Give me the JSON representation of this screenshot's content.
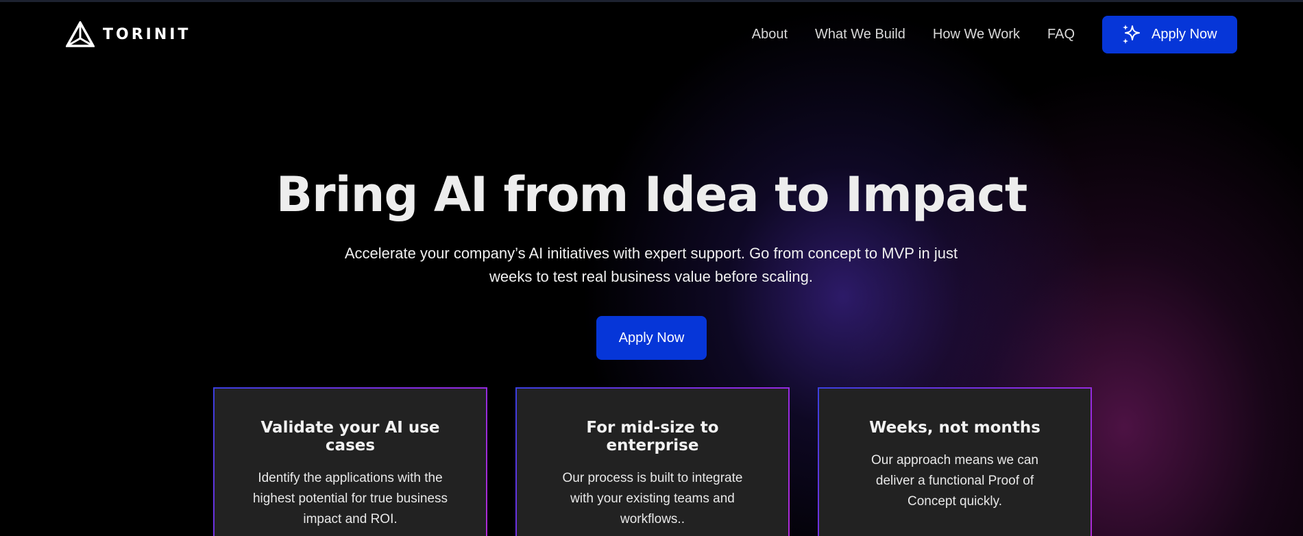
{
  "nav": {
    "brand": "TORINIT",
    "links": [
      "About",
      "What We Build",
      "How We Work",
      "FAQ"
    ],
    "cta_label": "Apply Now",
    "cta_icon": "sparkle-icon",
    "logo_icon": "triangle-logo-icon"
  },
  "hero": {
    "title": "Bring AI from Idea to Impact",
    "subtitle": "Accelerate your company’s AI initiatives with expert support. Go from concept to MVP in just weeks to test real business value before scaling.",
    "cta_label": "Apply Now"
  },
  "cards": [
    {
      "title": "Validate your AI use cases",
      "body": "Identify the applications with the highest potential for true business impact and ROI."
    },
    {
      "title": "For mid-size to enterprise",
      "body": "Our process is built to integrate with your existing teams and workflows.."
    },
    {
      "title": "Weeks, not months",
      "body": "Our approach means we can deliver a functional Proof of Concept quickly."
    }
  ],
  "colors": {
    "background": "#000000",
    "accent": "#0636d8",
    "card_bg": "#222222",
    "card_border": "#8a2be2"
  }
}
